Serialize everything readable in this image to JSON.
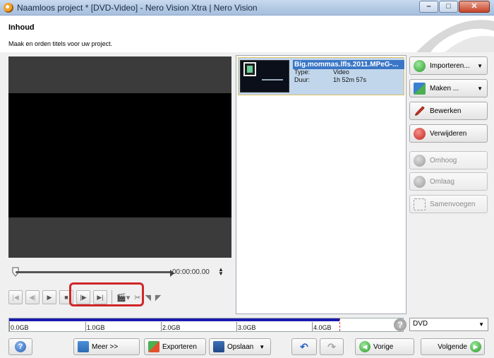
{
  "window": {
    "title": "Naamloos project * [DVD-Video] - Nero Vision Xtra | Nero Vision",
    "controls": {
      "minimize": "–",
      "maximize": "□",
      "close": "✕"
    }
  },
  "header": {
    "title": "Inhoud",
    "subtitle": "Maak en orden titels voor uw project."
  },
  "player": {
    "timecode": "00:00:00.00"
  },
  "media_list": {
    "items": [
      {
        "name": "Big.mommas.lfls.2011.MPeG-...",
        "type_label": "Type:",
        "type_value": "Video",
        "duration_label": "Duur:",
        "duration_value": "1h 52m 57s"
      }
    ]
  },
  "actions": {
    "import": "Importeren...",
    "make": "Maken ...",
    "edit": "Bewerken",
    "remove": "Verwijderen",
    "up": "Omhoog",
    "down": "Omlaag",
    "merge": "Samenvoegen"
  },
  "capacity": {
    "ticks": [
      "0.0GB",
      "1.0GB",
      "2.0GB",
      "3.0GB",
      "4.0GB"
    ],
    "used_fraction": 0.835,
    "disc_type": "DVD"
  },
  "bottom": {
    "more": "Meer >>",
    "export": "Exporteren",
    "save": "Opslaan",
    "previous": "Vorige",
    "next": "Volgende"
  },
  "colors": {
    "capacity_fill": "#1a1ab0",
    "selection": "#c1d6eb",
    "highlight_outline": "#d0262a"
  }
}
